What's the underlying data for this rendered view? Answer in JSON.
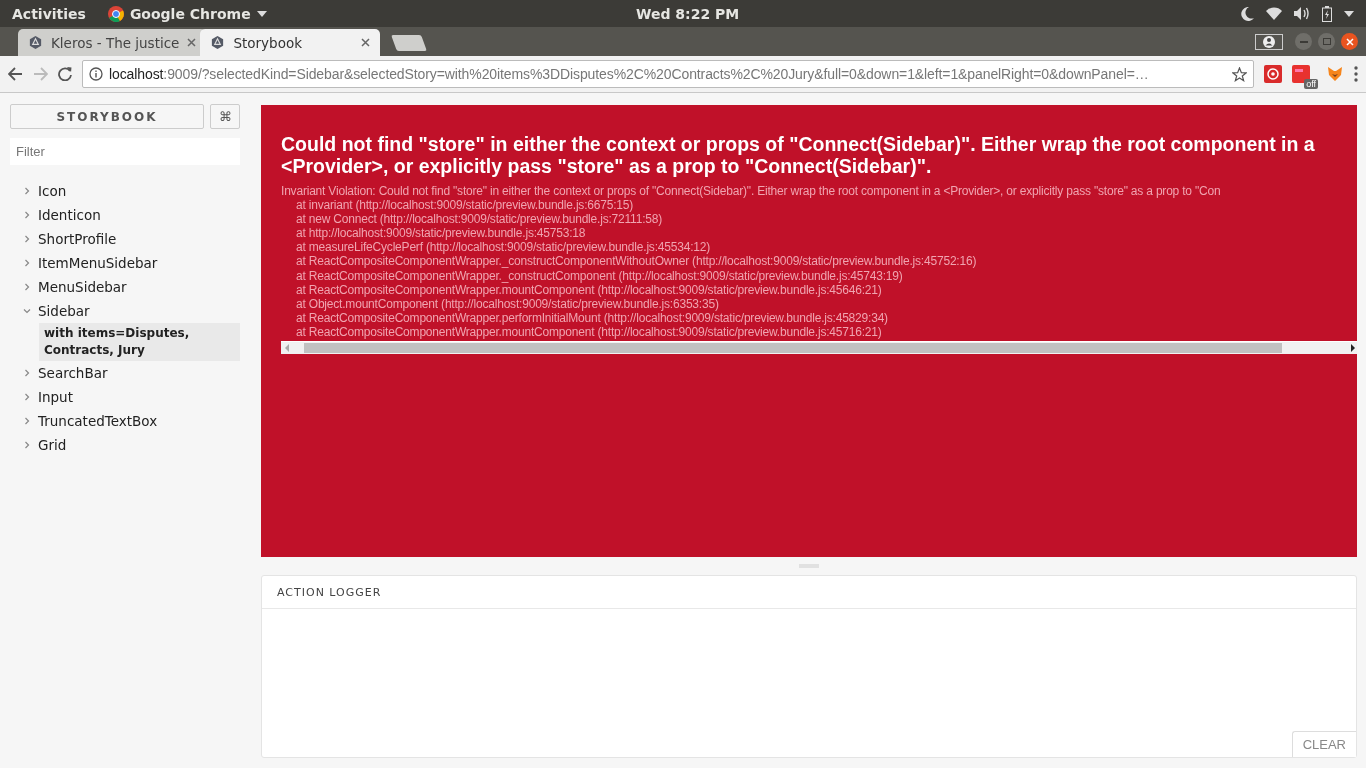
{
  "top_bar": {
    "activities": "Activities",
    "app": "Google Chrome",
    "clock": "Wed  8:22 PM"
  },
  "tabs": [
    {
      "title": "Kleros - The justice",
      "selected": false
    },
    {
      "title": "Storybook",
      "selected": true
    }
  ],
  "navigation": {
    "forward_disabled": true
  },
  "address_bar": {
    "host": "localhost",
    "rest": ":9009/?selectedKind=Sidebar&selectedStory=with%20items%3DDisputes%2C%20Contracts%2C%20Jury&full=0&down=1&left=1&panelRight=0&downPanel=…"
  },
  "extension_badge": "off",
  "sidebar": {
    "header": "STORYBOOK",
    "shortcut": "⌘",
    "filter_placeholder": "Filter",
    "kinds": [
      {
        "label": "Icon",
        "expanded": false
      },
      {
        "label": "Identicon",
        "expanded": false
      },
      {
        "label": "ShortProfile",
        "expanded": false
      },
      {
        "label": "ItemMenuSidebar",
        "expanded": false
      },
      {
        "label": "MenuSidebar",
        "expanded": false
      },
      {
        "label": "Sidebar",
        "expanded": true,
        "stories": [
          {
            "label": "with items=Disputes, Contracts, Jury",
            "selected": true
          }
        ]
      },
      {
        "label": "SearchBar",
        "expanded": false
      },
      {
        "label": "Input",
        "expanded": false
      },
      {
        "label": "TruncatedTextBox",
        "expanded": false
      },
      {
        "label": "Grid",
        "expanded": false
      }
    ]
  },
  "error": {
    "title": "Could not find \"store\" in either the context or props of \"Connect(Sidebar)\". Either wrap the root component in a <Provider>, or explicitly pass \"store\" as a prop to \"Connect(Sidebar)\".",
    "message": "Invariant Violation: Could not find \"store\" in either the context or props of \"Connect(Sidebar)\". Either wrap the root component in a <Provider>, or explicitly pass \"store\" as a prop to \"Con",
    "stack": [
      "at invariant (http://localhost:9009/static/preview.bundle.js:6675:15)",
      "at new Connect (http://localhost:9009/static/preview.bundle.js:72111:58)",
      "at http://localhost:9009/static/preview.bundle.js:45753:18",
      "at measureLifeCyclePerf (http://localhost:9009/static/preview.bundle.js:45534:12)",
      "at ReactCompositeComponentWrapper._constructComponentWithoutOwner (http://localhost:9009/static/preview.bundle.js:45752:16)",
      "at ReactCompositeComponentWrapper._constructComponent (http://localhost:9009/static/preview.bundle.js:45743:19)",
      "at ReactCompositeComponentWrapper.mountComponent (http://localhost:9009/static/preview.bundle.js:45646:21)",
      "at Object.mountComponent (http://localhost:9009/static/preview.bundle.js:6353:35)",
      "at ReactCompositeComponentWrapper.performInitialMount (http://localhost:9009/static/preview.bundle.js:45829:34)",
      "at ReactCompositeComponentWrapper.mountComponent (http://localhost:9009/static/preview.bundle.js:45716:21)"
    ]
  },
  "action_logger": {
    "title": "ACTION LOGGER",
    "clear": "CLEAR"
  }
}
